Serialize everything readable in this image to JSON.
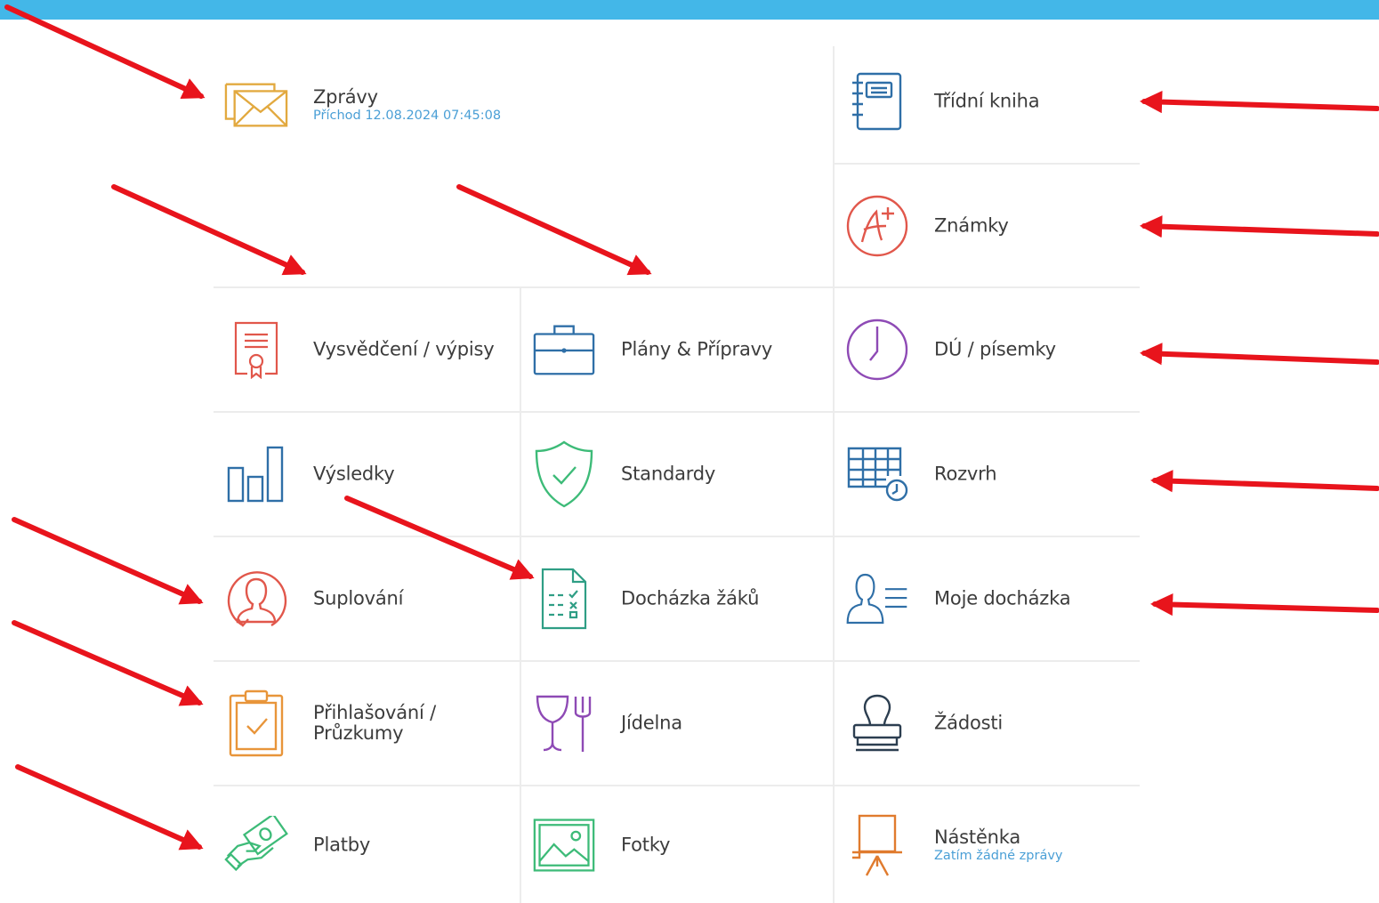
{
  "tiles": {
    "zpravy": {
      "label": "Zprávy",
      "sub": "Příchod 12.08.2024 07:45:08",
      "icon": "envelope-icon",
      "color": "#e2a93f"
    },
    "tridni_kniha": {
      "label": "Třídní kniha",
      "icon": "notebook-icon",
      "color": "#2f6fa7"
    },
    "znamky": {
      "label": "Známky",
      "icon": "grade-a-plus-icon",
      "color": "#e1574b"
    },
    "vysvedceni": {
      "label": "Vysvědčení / výpisy",
      "icon": "certificate-icon",
      "color": "#e1574b"
    },
    "plany": {
      "label": "Plány & Přípravy",
      "icon": "briefcase-icon",
      "color": "#2f6fa7"
    },
    "du": {
      "label": "DÚ / písemky",
      "icon": "clock-icon",
      "color": "#8e4ab5"
    },
    "vysledky": {
      "label": "Výsledky",
      "icon": "bar-chart-icon",
      "color": "#2f6fa7"
    },
    "standardy": {
      "label": "Standardy",
      "icon": "shield-check-icon",
      "color": "#3dbb78"
    },
    "rozvrh": {
      "label": "Rozvrh",
      "icon": "timetable-icon",
      "color": "#2f6fa7"
    },
    "suplovani": {
      "label": "Suplování",
      "icon": "person-swap-icon",
      "color": "#e1574b"
    },
    "dochazka_zaku": {
      "label": "Docházka žáků",
      "icon": "attendance-sheet-icon",
      "color": "#2f9e85"
    },
    "moje_dochazka": {
      "label": "Moje docházka",
      "icon": "person-list-icon",
      "color": "#2f6fa7"
    },
    "prihlasovani": {
      "label1": "Přihlašování /",
      "label2": "Průzkumy",
      "icon": "clipboard-check-icon",
      "color": "#e8953a"
    },
    "jidelna": {
      "label": "Jídelna",
      "icon": "glass-fork-icon",
      "color": "#8e4ab5"
    },
    "zadosti": {
      "label": "Žádosti",
      "icon": "stamp-icon",
      "color": "#2c3e50"
    },
    "platby": {
      "label": "Platby",
      "icon": "money-hand-icon",
      "color": "#3dbb78"
    },
    "fotky": {
      "label": "Fotky",
      "icon": "picture-icon",
      "color": "#3dbb78"
    },
    "nastenka": {
      "label": "Nástěnka",
      "sub": "Zatím žádné zprávy",
      "icon": "easel-board-icon",
      "color": "#e07b2e"
    }
  },
  "colors": {
    "topbar": "#43b7e8",
    "arrow": "#e8141c",
    "subtext": "#4a9fd6"
  }
}
